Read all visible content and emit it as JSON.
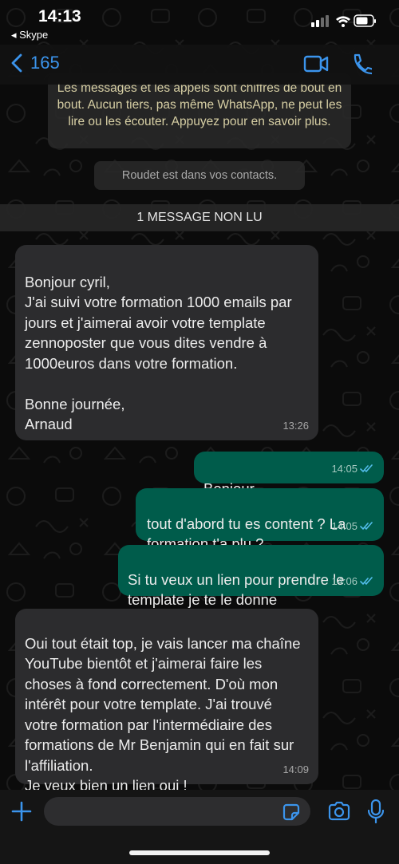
{
  "status_bar": {
    "time": "14:13",
    "back_app": "◂ Skype"
  },
  "nav": {
    "back_count": "165"
  },
  "encryption_notice": "Les messages et les appels sont chiffrés de bout en bout. Aucun tiers, pas même WhatsApp, ne peut les lire ou les écouter. Appuyez pour en savoir plus.",
  "contact_notice": "Roudet est dans vos contacts.",
  "unread_label": "1 MESSAGE NON LU",
  "messages": [
    {
      "direction": "in",
      "text": "Bonjour cyril,\nJ'ai suivi votre formation 1000 emails par jours et j'aimerai avoir votre template  zennoposter que vous dites vendre à 1000euros dans votre formation.\n\nBonne journée,\nArnaud",
      "time": "13:26"
    },
    {
      "direction": "out",
      "text": "Bonjour",
      "time": "14:05",
      "read": true
    },
    {
      "direction": "out",
      "text": "tout d'abord tu es content ? La formation t'a plu ?",
      "time": "14:05",
      "read": true
    },
    {
      "direction": "out",
      "text": "Si tu veux un lien pour prendre le template je te le donne",
      "time": "14:06",
      "read": true
    },
    {
      "direction": "in",
      "text": "Oui tout était top, je vais lancer ma chaîne YouTube bientôt et j'aimerai faire les choses à fond correctement. D'où mon intérêt pour votre template. J'ai trouvé votre formation par l'intermédiaire des formations de Mr Benjamin qui en fait sur l'affiliation.\nJe veux bien un lien oui !",
      "time": "14:09"
    }
  ],
  "composer": {
    "input_value": ""
  },
  "icons": {
    "back": "chevron-left-icon",
    "video": "video-camera-icon",
    "call": "phone-icon",
    "plus": "plus-icon",
    "sticker": "sticker-icon",
    "camera": "camera-icon",
    "mic": "microphone-icon",
    "read_receipt": "double-check-icon"
  },
  "colors": {
    "accent": "#3b94ec",
    "outgoing_bubble": "#005c4b",
    "incoming_bubble": "#2c2c2e",
    "notice_text": "#d7cfa4",
    "read_tick": "#53bdeb"
  }
}
